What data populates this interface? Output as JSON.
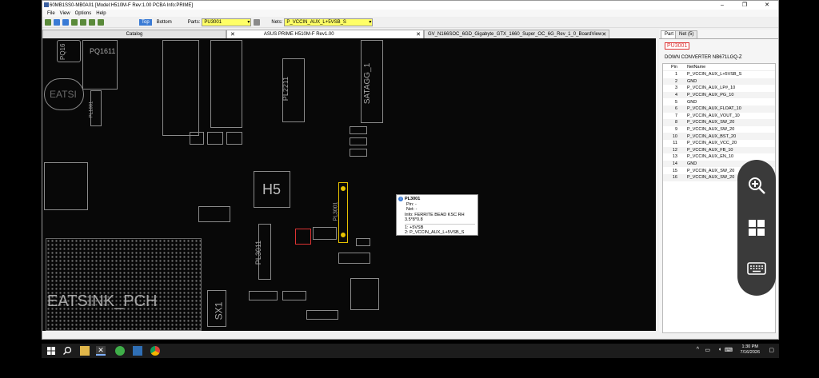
{
  "window": {
    "title": "60MB1SS0-MB0A01 [Model:H510M-F Rev:1.00 PCBA Info:PRIME]",
    "minimize_glyph": "–",
    "maximize_glyph": "❐",
    "close_glyph": "✕"
  },
  "menu": [
    "File",
    "View",
    "Options",
    "Help"
  ],
  "toolbar": {
    "top_label": "Top",
    "bottom_label": "Bottom",
    "parts_label": "Parts:",
    "parts_value": "PU3001",
    "nets_label": "Nets:",
    "nets_value": "P_VCCIN_AUX_L+5VSB_S"
  },
  "tabs": [
    {
      "label": "Catalog"
    },
    {
      "label": "ASUS PRIME H510M-F Rev1.00"
    },
    {
      "label": "GV_N166SOC_6GD_Gigabyte_GTX_1660_Super_OC_6G_Rev_1_0_BoardView"
    }
  ],
  "board": {
    "labels": {
      "pq16": "PQ16",
      "pq1611": "PQ1611",
      "pl2211": "PL2211",
      "satagg": "SATAGG_1",
      "h5": "H5",
      "pl3001": "PL3001",
      "pl3011": "PL3011",
      "pl1001": "PL1001",
      "heatsink": "EATSINK_PCH",
      "sx1": "SX1"
    }
  },
  "tooltip": {
    "title": "PL3001",
    "pin": "Pin: -",
    "net": "Net: -",
    "info": "Info: FERRITE BEAD KSC RH 3.5*8*0.8",
    "pin1": "1: +5VSB",
    "pin2": "2: P_VCCIN_AUX_L+5VSB_S"
  },
  "right_panel": {
    "tabs": [
      "Part",
      "Net (5)"
    ],
    "part": "PU3001",
    "description": "DOWN CONVERTER NB671LGQ-Z",
    "headers": {
      "pin": "Pin",
      "net": "NetName"
    },
    "pins": [
      {
        "pin": "1",
        "net": "P_VCCIN_AUX_L+5VSB_S"
      },
      {
        "pin": "2",
        "net": "GND"
      },
      {
        "pin": "3",
        "net": "P_VCCIN_AUX_LP#_10"
      },
      {
        "pin": "4",
        "net": "P_VCCIN_AUX_PG_10"
      },
      {
        "pin": "5",
        "net": "GND"
      },
      {
        "pin": "6",
        "net": "P_VCCIN_AUX_FLOAT_10"
      },
      {
        "pin": "7",
        "net": "P_VCCIN_AUX_VOUT_10"
      },
      {
        "pin": "8",
        "net": "P_VCCIN_AUX_SW_20"
      },
      {
        "pin": "9",
        "net": "P_VCCIN_AUX_SW_20"
      },
      {
        "pin": "10",
        "net": "P_VCCIN_AUX_BST_20"
      },
      {
        "pin": "11",
        "net": "P_VCCIN_AUX_VCC_20"
      },
      {
        "pin": "12",
        "net": "P_VCCIN_AUX_FB_10"
      },
      {
        "pin": "13",
        "net": "P_VCCIN_AUX_EN_10"
      },
      {
        "pin": "14",
        "net": "GND"
      },
      {
        "pin": "15",
        "net": "P_VCCIN_AUX_SW_20"
      },
      {
        "pin": "16",
        "net": "P_VCCIN_AUX_SW_20"
      }
    ]
  },
  "taskbar": {
    "time": "1:30 PM",
    "date": "7/16/2026"
  },
  "colors": {
    "highlight": "#ffff66",
    "accent": "#3a7bd5",
    "part_red": "#d33333",
    "selection": "#e6c200"
  }
}
